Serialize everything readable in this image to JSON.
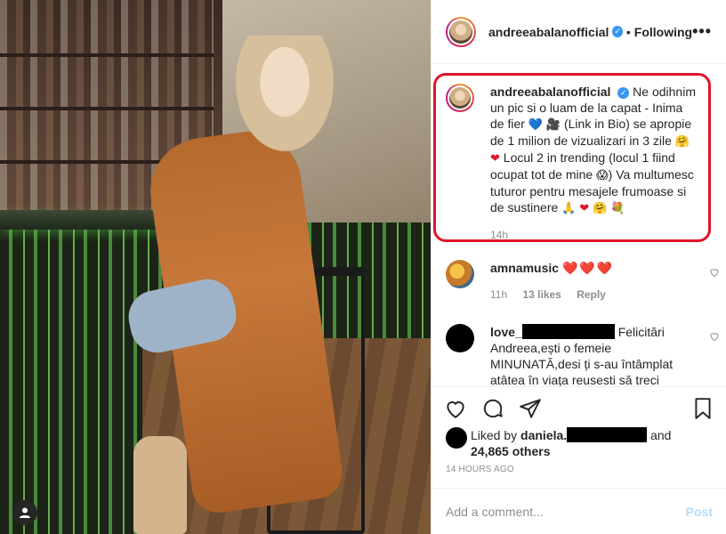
{
  "post": {
    "username": "andreeabalanofficial",
    "follow_state": "Following",
    "more_label": "•••"
  },
  "caption": {
    "username": "andreeabalanofficial",
    "text_part1": "Ne odihnim un pic si o luam de la capat - Inima de fier",
    "text_part2": "(Link in Bio) se apropie de 1 milion de vizualizari in 3 zile",
    "text_part3": "Locul 2 in trending (locul 1 fiind ocupat tot de mine",
    "text_part4": ") Va multumesc tuturor pentru mesajele frumoase si de sustinere",
    "time": "14h"
  },
  "comments": [
    {
      "username": "amnamusic",
      "text": "❤️❤️❤️",
      "time": "11h",
      "likes": "13 likes",
      "reply": "Reply"
    },
    {
      "username_prefix": "love_",
      "text": "Felicitări Andreea,ești o femeie MINUNATĂ,desi ți s-au întâmplat atâtea în viața reusesti să treci"
    }
  ],
  "likes_line": {
    "prefix": "Liked by",
    "user_prefix": "daniela.",
    "and": "and",
    "others": "24,865 others"
  },
  "timestamp": "14 HOURS AGO",
  "add_comment": {
    "placeholder": "Add a comment...",
    "post_label": "Post"
  },
  "colors": {
    "highlight_border": "#e0142a",
    "verified": "#3897f0",
    "post_button_disabled": "#b2dffc"
  }
}
